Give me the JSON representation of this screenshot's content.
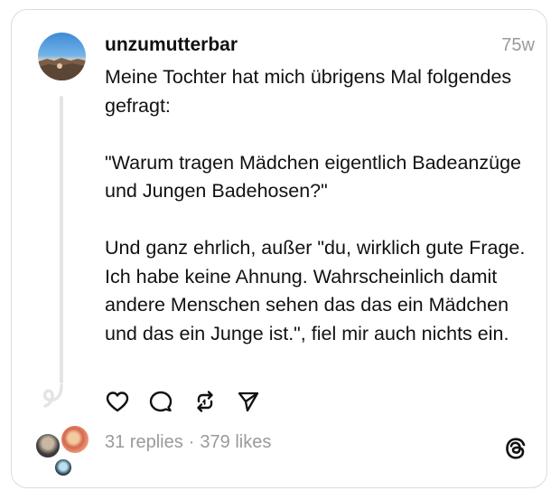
{
  "post": {
    "username": "unzumutterbar",
    "time": "75w",
    "text": "Meine Tochter hat mich übrigens Mal folgendes gefragt:\n\n\"Warum tragen Mädchen eigentlich Badeanzüge und Jungen Badehosen?\"\n\nUnd ganz ehrlich, außer \"du, wirklich gute Frage. Ich habe keine Ahnung. Wahrscheinlich damit andere Menschen sehen das das ein Mädchen und das ein Junge ist.\", fiel mir auch nichts ein."
  },
  "actions": {
    "icons": [
      "heart-icon",
      "comment-icon",
      "repost-icon",
      "share-icon"
    ]
  },
  "stats": {
    "replies": "31 replies",
    "separator": "·",
    "likes": "379 likes"
  },
  "colors": {
    "text": "#111111",
    "muted": "#9a9a9a",
    "border": "#dcdcdc",
    "thread_line": "#e4e4e4"
  }
}
